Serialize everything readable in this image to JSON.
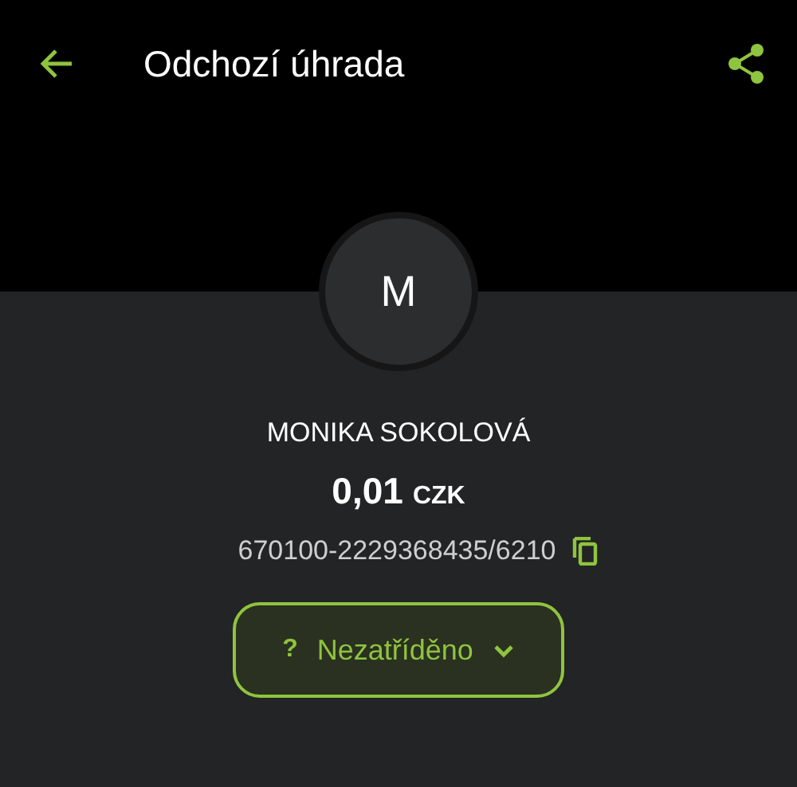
{
  "app_bar": {
    "title": "Odchozí úhrada"
  },
  "avatar": {
    "initial": "M"
  },
  "counterparty": {
    "name": "MONIKA SOKOLOVÁ",
    "amount": "0,01",
    "currency": "CZK",
    "account": "670100-2229368435/6210"
  },
  "category": {
    "icon": "?",
    "label": "Nezatříděno"
  }
}
